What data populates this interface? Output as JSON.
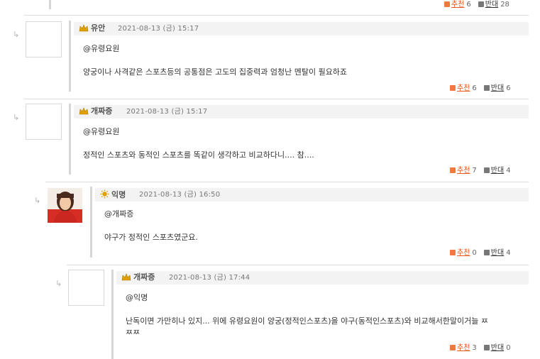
{
  "top_votes": {
    "up_label": "추천",
    "up_count": "6",
    "down_label": "반대",
    "down_count": "28"
  },
  "comments": [
    {
      "nickname": "유안",
      "date": "2021-08-13 (금) 15:17",
      "mention": "@유령요원",
      "body": "양궁이나 사격같은 스포츠등의 공통점은 고도의 집중력과 엄청난 멘탈이 필요하죠",
      "up_label": "추천",
      "up_count": "6",
      "down_label": "반대",
      "down_count": "6"
    },
    {
      "nickname": "개짜증",
      "date": "2021-08-13 (금) 15:17",
      "mention": "@유령요원",
      "body": "정적인 스포츠와 동적인 스포츠를 똑같이 생각하고 비교하다니.... 참....",
      "up_label": "추천",
      "up_count": "7",
      "down_label": "반대",
      "down_count": "4"
    },
    {
      "nickname": "익명",
      "date": "2021-08-13 (금) 16:50",
      "mention": "@개짜증",
      "body": "야구가 정적인 스포츠였군요.",
      "up_label": "추천",
      "up_count": "0",
      "down_label": "반대",
      "down_count": "4"
    },
    {
      "nickname": "개짜증",
      "date": "2021-08-13 (금) 17:44",
      "mention": "@익명",
      "body_line1": "난독이면 가만히나 있지... 위에 유령요원이 양궁(정적인스포츠)을 야구(동적인스포츠)와 비교해서한말이거늘 ㅉ",
      "body_line2": "ㅉㅉ",
      "up_label": "추천",
      "up_count": "3",
      "down_label": "반대",
      "down_count": "0"
    }
  ],
  "icons": {
    "reply": "reply-arrow-icon",
    "crown": "crown-icon",
    "up": "thumbs-up-icon",
    "down": "thumbs-down-icon"
  },
  "colors": {
    "up_link": "#e8541a",
    "crown_gold": "#e0a100",
    "divider": "#dcdcdc"
  }
}
